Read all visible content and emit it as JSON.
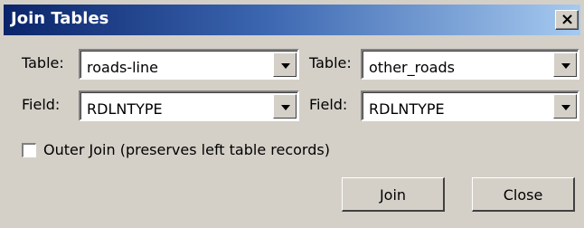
{
  "window": {
    "title": "Join Tables",
    "close_glyph": "×"
  },
  "left": {
    "table_label": "Table:",
    "table_value": "roads-line",
    "field_label": "Field:",
    "field_value": "RDLNTYPE"
  },
  "right": {
    "table_label": "Table:",
    "table_value": "other_roads",
    "field_label": "Field:",
    "field_value": "RDLNTYPE"
  },
  "outer_join": {
    "label": "Outer Join (preserves left table records)",
    "checked": false
  },
  "buttons": {
    "join": "Join",
    "close": "Close"
  }
}
